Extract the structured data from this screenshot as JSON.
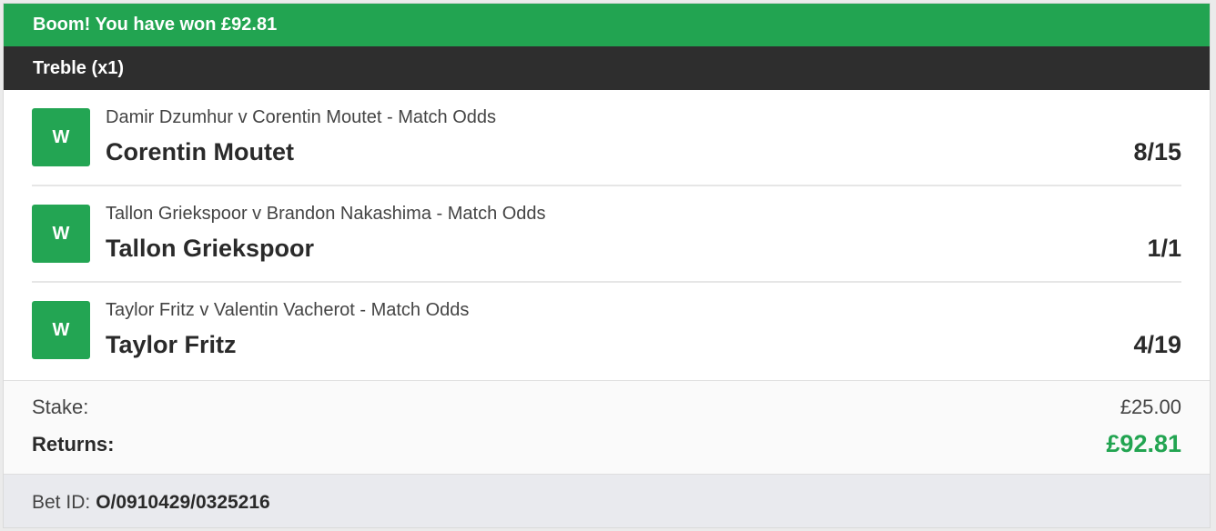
{
  "banner": {
    "text": "Boom! You have won £92.81"
  },
  "bet_type": {
    "label": "Treble (x1)"
  },
  "legs": [
    {
      "result": "W",
      "market": "Damir Dzumhur v Corentin Moutet - Match Odds",
      "selection": "Corentin Moutet",
      "odds": "8/15"
    },
    {
      "result": "W",
      "market": "Tallon Griekspoor v Brandon Nakashima - Match Odds",
      "selection": "Tallon Griekspoor",
      "odds": "1/1"
    },
    {
      "result": "W",
      "market": "Taylor Fritz v Valentin Vacherot - Match Odds",
      "selection": "Taylor Fritz",
      "odds": "4/19"
    }
  ],
  "totals": {
    "stake_label": "Stake:",
    "stake_value": "£25.00",
    "returns_label": "Returns:",
    "returns_value": "£92.81"
  },
  "footer": {
    "bet_id_label": "Bet ID:",
    "bet_id_value": "O/0910429/0325216"
  },
  "colors": {
    "win_green": "#22a451",
    "header_dark": "#2e2e2e"
  }
}
